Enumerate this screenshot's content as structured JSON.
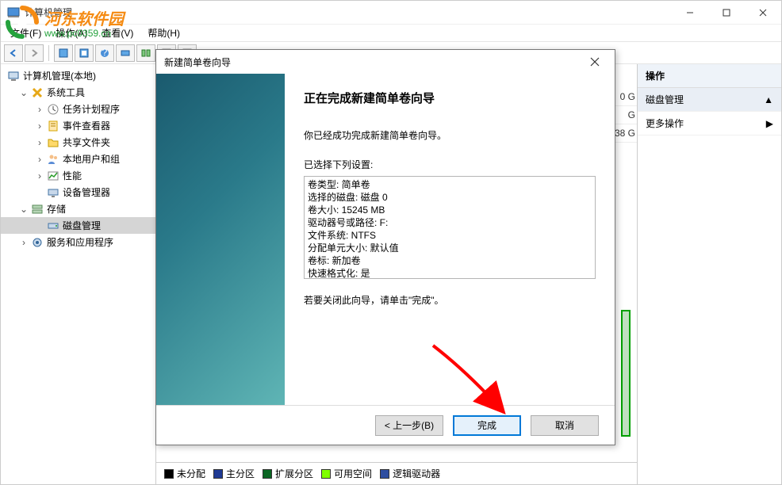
{
  "window": {
    "title": "计算机管理"
  },
  "watermark": {
    "title": "河东软件园",
    "url": "www.pc0359.cn"
  },
  "menu": {
    "file": "文件(F)",
    "action": "操作(A)",
    "view": "查看(V)",
    "help": "帮助(H)"
  },
  "tree": {
    "root": "计算机管理(本地)",
    "systools": "系统工具",
    "task": "任务计划程序",
    "event": "事件查看器",
    "shared": "共享文件夹",
    "users": "本地用户和组",
    "perf": "性能",
    "devmgr": "设备管理器",
    "storage": "存储",
    "disk": "磁盘管理",
    "services": "服务和应用程序"
  },
  "right": {
    "header": "操作",
    "item1": "磁盘管理",
    "item2": "更多操作"
  },
  "partial": {
    "a": "0 G",
    "b": "G",
    "c": "38 G"
  },
  "legend": {
    "unalloc": "未分配",
    "primary": "主分区",
    "extended": "扩展分区",
    "free": "可用空间",
    "logical": "逻辑驱动器",
    "colors": {
      "unalloc": "#000000",
      "primary": "#1f3a93",
      "extended": "#0b6623",
      "free": "#7fff00",
      "logical": "#2e4ea0"
    }
  },
  "dialog": {
    "title": "新建简单卷向导",
    "heading": "正在完成新建简单卷向导",
    "body1": "你已经成功完成新建简单卷向导。",
    "list_label": "已选择下列设置:",
    "settings": [
      "卷类型: 简单卷",
      "选择的磁盘: 磁盘 0",
      "卷大小: 15245 MB",
      "驱动器号或路径: F:",
      "文件系统: NTFS",
      "分配单元大小: 默认值",
      "卷标: 新加卷",
      "快速格式化: 是"
    ],
    "body2": "若要关闭此向导，请单击\"完成\"。",
    "back": "< 上一步(B)",
    "finish": "完成",
    "cancel": "取消"
  }
}
